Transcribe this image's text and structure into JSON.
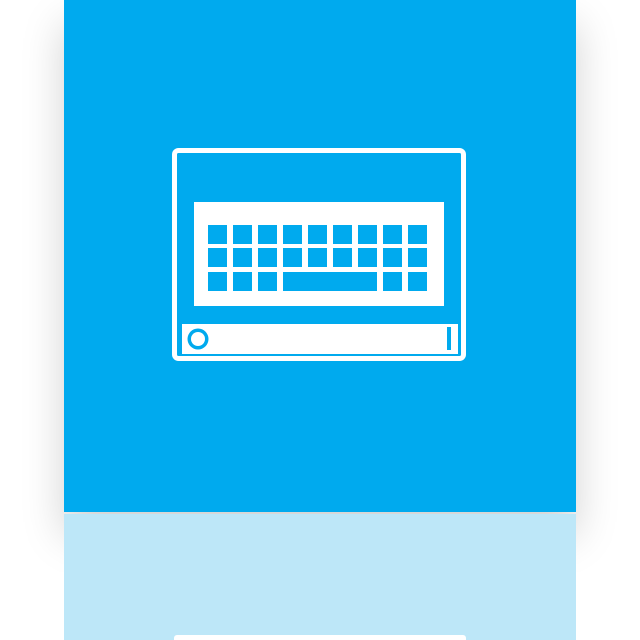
{
  "tile": {
    "icon_name": "on-screen-keyboard-icon",
    "color": "#00AAEE",
    "reflection_color": "#BDE7F8"
  }
}
